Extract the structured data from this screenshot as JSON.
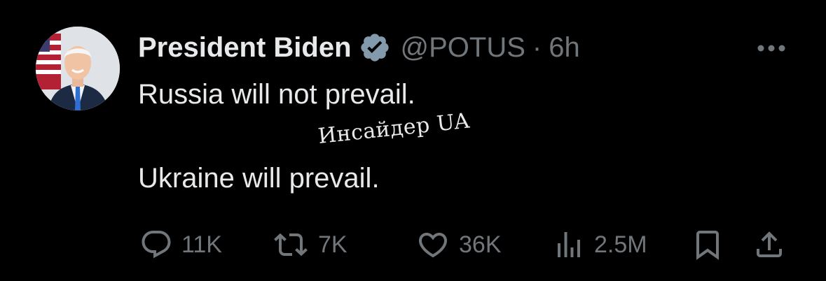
{
  "post": {
    "author": {
      "display_name": "President Biden",
      "handle": "@POTUS",
      "separator": "·",
      "time": "6h",
      "verified_icon": "verified-badge-icon",
      "avatar": "avatar-photo"
    },
    "text_line1": "Russia will not prevail.",
    "text_line2": "Ukraine will prevail.",
    "watermark": "Инсайдер UA"
  },
  "actions": {
    "reply": {
      "icon": "reply-icon",
      "count": "11K"
    },
    "repost": {
      "icon": "repost-icon",
      "count": "7K"
    },
    "like": {
      "icon": "heart-icon",
      "count": "36K"
    },
    "views": {
      "icon": "views-chart-icon",
      "count": "2.5M"
    },
    "bookmark": {
      "icon": "bookmark-icon"
    },
    "share": {
      "icon": "share-icon"
    }
  },
  "colors": {
    "background": "#000000",
    "text": "#e7e9ea",
    "muted": "#71767b",
    "verified": "#829aab"
  }
}
